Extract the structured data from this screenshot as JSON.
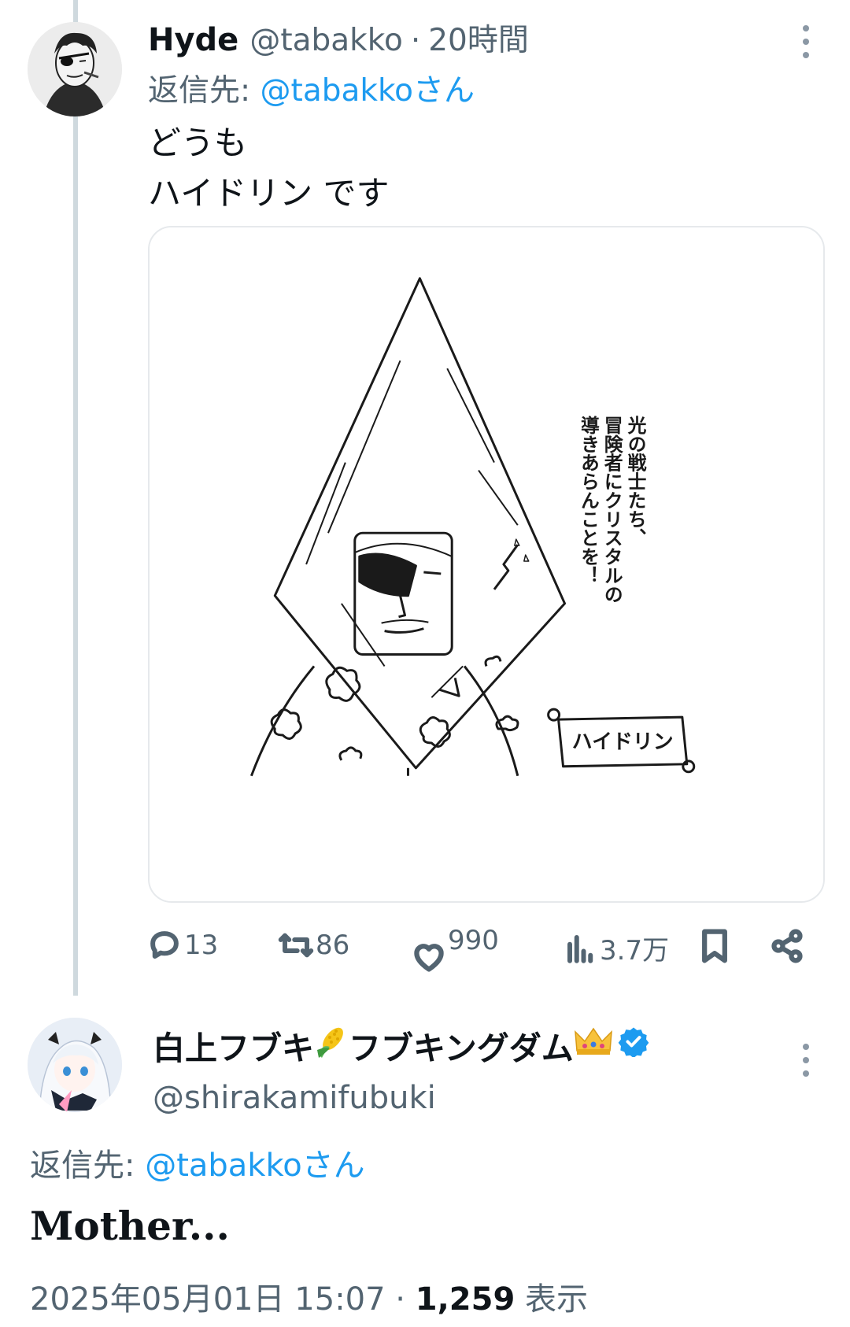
{
  "tweet1": {
    "display_name": "Hyde",
    "handle": "@tabakko",
    "separator": "·",
    "time": "20時間",
    "reply_prefix": "返信先: ",
    "reply_handle": "@tabakkoさん",
    "body_line1": "どうも",
    "body_line2": "ハイドリン です",
    "image": {
      "caption_vertical": [
        "光の戦士たち、",
        "冒険者にクリスタルの",
        "導きあらんことを！"
      ],
      "nameplate": "ハイドリン"
    },
    "actions": {
      "replies": "13",
      "reposts": "86",
      "likes": "990",
      "views": "3.7万"
    },
    "icons": [
      "more-icon",
      "reply-icon",
      "repost-icon",
      "like-icon",
      "views-icon",
      "bookmark-icon",
      "share-icon"
    ]
  },
  "tweet2": {
    "display_name": "白上フブキ",
    "display_name_mid": "フブキングダム",
    "name_emojis": [
      "corn-emoji",
      "crown-emoji",
      "verified-badge-icon"
    ],
    "handle": "@shirakamifubuki",
    "reply_prefix": "返信先: ",
    "reply_handle": "@tabakkoさん",
    "body": "Mother...",
    "timestamp": "2025年05月01日 15:07",
    "separator": " · ",
    "view_count": "1,259",
    "view_label": " 表示"
  },
  "colors": {
    "link": "#1d9bf0",
    "secondary_text": "#536471",
    "thread_line": "#cfd9de",
    "verified": "#1d9bf0"
  }
}
